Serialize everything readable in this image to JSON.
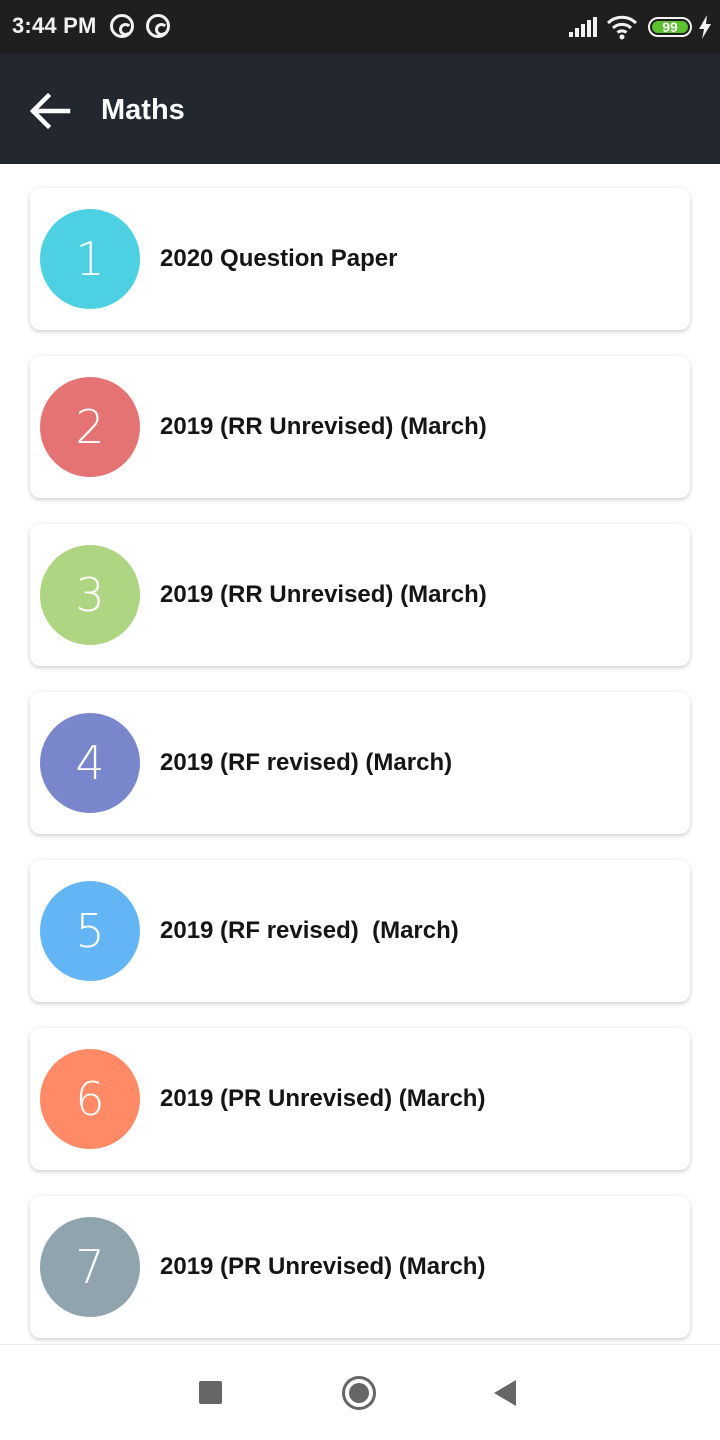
{
  "status_bar": {
    "time": "3:44 PM",
    "notification_icons": [
      "q-app-icon",
      "q-app-icon"
    ],
    "battery_level": "99",
    "charging": true
  },
  "app_bar": {
    "title": "Maths",
    "back_icon": "arrow-left-icon"
  },
  "papers": [
    {
      "number": "1",
      "title": "2020 Question Paper",
      "color": "#4DD0E1"
    },
    {
      "number": "2",
      "title": "2019 (RR Unrevised) (March)",
      "color": "#E57373"
    },
    {
      "number": "3",
      "title": "2019 (RR Unrevised) (March)",
      "color": "#AED581"
    },
    {
      "number": "4",
      "title": "2019 (RF revised) (March)",
      "color": "#7986CB"
    },
    {
      "number": "5",
      "title": "2019 (RF revised)  (March)",
      "color": "#64B5F6"
    },
    {
      "number": "6",
      "title": "2019 (PR Unrevised) (March)",
      "color": "#FF8A65"
    },
    {
      "number": "7",
      "title": "2019 (PR Unrevised) (March)",
      "color": "#90A4AE"
    }
  ],
  "nav_bar": {
    "recents_icon": "square-icon",
    "home_icon": "circle-icon",
    "back_icon": "triangle-back-icon"
  }
}
